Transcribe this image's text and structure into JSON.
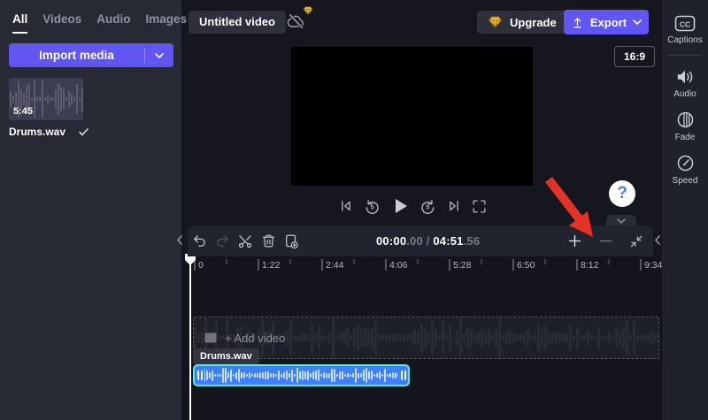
{
  "header": {
    "title": "Untitled video",
    "upgrade_label": "Upgrade",
    "export_label": "Export"
  },
  "library": {
    "tabs": [
      {
        "label": "All",
        "active": true
      },
      {
        "label": "Videos",
        "active": false
      },
      {
        "label": "Audio",
        "active": false
      },
      {
        "label": "Images",
        "active": false
      }
    ],
    "import_button_label": "Import media",
    "media": [
      {
        "name": "Drums.wav",
        "duration": "5:45",
        "selected": true
      }
    ]
  },
  "preview": {
    "aspect_ratio_badge": "16:9"
  },
  "right_panel": {
    "items": [
      {
        "label": "Captions",
        "icon": "captions-icon"
      },
      {
        "label": "Audio",
        "icon": "audio-icon"
      },
      {
        "label": "Fade",
        "icon": "fade-icon"
      },
      {
        "label": "Speed",
        "icon": "speed-icon"
      }
    ]
  },
  "toolbar": {
    "timecode": {
      "current": "00:00",
      "current_frames": ".00",
      "separator": " / ",
      "total": "04:51",
      "total_frames": ".56"
    }
  },
  "timeline": {
    "ruler_labels": [
      "0",
      "1:22",
      "2:44",
      "4:06",
      "5:28",
      "6:50",
      "8:12",
      "9:34"
    ],
    "add_video_placeholder": "+ Add video",
    "clip": {
      "name": "Drums.wav"
    }
  },
  "help_button": {
    "glyph": "?"
  },
  "colors": {
    "accent": "#6156F1",
    "clip_fill": "#3E80F8",
    "clip_border": "#63E6D2",
    "annotation_arrow": "#E33226",
    "gem": "#F3B93C"
  }
}
